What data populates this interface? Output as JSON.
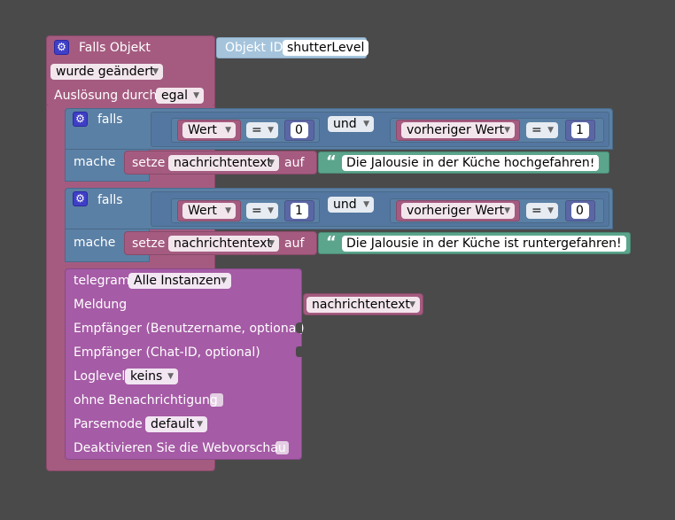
{
  "trigger": {
    "title": "Falls Objekt",
    "object_label": "Objekt ID",
    "object_id": "shutterLevel",
    "changed": "wurde geändert",
    "trigger_by_label": "Auslösung durch",
    "trigger_by_value": "egal"
  },
  "if1": {
    "falls": "falls",
    "wert": "Wert",
    "op1": "=",
    "val1": "0",
    "and": "und",
    "prev": "vorheriger Wert",
    "op2": "=",
    "val2": "1",
    "mache": "mache",
    "setze": "setze",
    "var": "nachrichtentext",
    "auf": "auf",
    "text": "Die Jalousie in der Küche hochgefahren!"
  },
  "if2": {
    "falls": "falls",
    "wert": "Wert",
    "op1": "=",
    "val1": "1",
    "and": "und",
    "prev": "vorheriger Wert",
    "op2": "=",
    "val2": "0",
    "mache": "mache",
    "setze": "setze",
    "var": "nachrichtentext",
    "auf": "auf",
    "text": "Die Jalousie in der Küche ist runtergefahren!"
  },
  "telegram": {
    "title": "telegram",
    "instance": "Alle Instanzen",
    "message_label": "Meldung",
    "message_var": "nachrichtentext",
    "recipient_user": "Empfänger (Benutzername, optional)",
    "recipient_chat": "Empfänger (Chat-ID, optional)",
    "loglevel_label": "Loglevel",
    "loglevel_value": "keins",
    "silent_label": "ohne Benachrichtigung",
    "parsemode_label": "Parsemode",
    "parsemode_value": "default",
    "disable_preview_label": "Deaktivieren Sie die Webvorschau"
  },
  "icons": {
    "gear": "gear-icon",
    "dropdown": "dropdown-arrow-icon",
    "quote_open": "“",
    "quote_close": "”"
  },
  "colors": {
    "background": "#4a4a4a",
    "trigger": "#a55b80",
    "logic": "#5b80a5",
    "telegram": "#a55ba5",
    "text": "#5ba58c",
    "number": "#5b67a5"
  }
}
